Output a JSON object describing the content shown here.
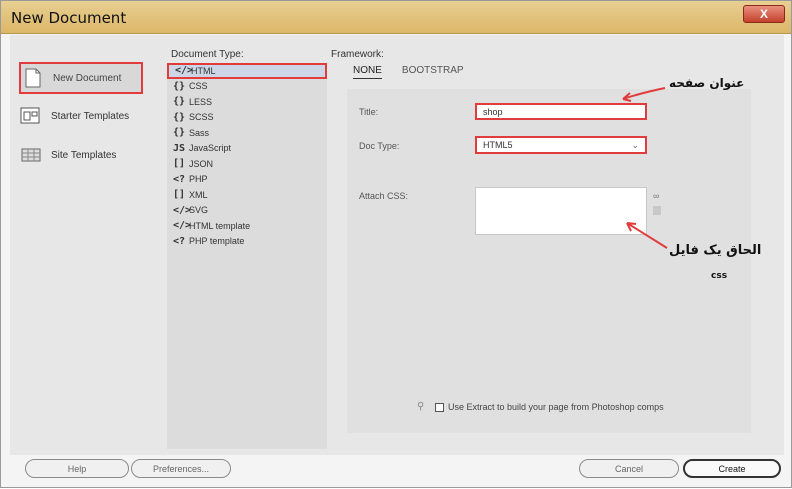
{
  "window": {
    "title": "New Document",
    "close_label": "X"
  },
  "nav": {
    "items": [
      {
        "label": "New Document",
        "icon": "document-icon"
      },
      {
        "label": "Starter Templates",
        "icon": "starter-templates-icon"
      },
      {
        "label": "Site Templates",
        "icon": "site-templates-icon"
      }
    ]
  },
  "doc_type": {
    "label": "Document Type:",
    "items": [
      {
        "label": "HTML",
        "icon": "</>"
      },
      {
        "label": "CSS",
        "icon": "{}"
      },
      {
        "label": "LESS",
        "icon": "{}"
      },
      {
        "label": "SCSS",
        "icon": "{}"
      },
      {
        "label": "Sass",
        "icon": "{}"
      },
      {
        "label": "JavaScript",
        "icon": "JS"
      },
      {
        "label": "JSON",
        "icon": "[]"
      },
      {
        "label": "PHP",
        "icon": "<?"
      },
      {
        "label": "XML",
        "icon": "[]"
      },
      {
        "label": "SVG",
        "icon": "</>"
      },
      {
        "label": "HTML template",
        "icon": "</>"
      },
      {
        "label": "PHP template",
        "icon": "<?"
      }
    ]
  },
  "framework": {
    "label": "Framework:",
    "tabs": [
      "NONE",
      "BOOTSTRAP"
    ],
    "title_label": "Title:",
    "title_value": "shop",
    "doctype_label": "Doc Type:",
    "doctype_value": "HTML5",
    "attach_label": "Attach CSS:",
    "extract_text": "Use Extract to build your page from Photoshop comps"
  },
  "annotations": {
    "page_title": "عنوان صفحه",
    "attach_file": "الحاق یک فایل",
    "css": "css"
  },
  "buttons": {
    "help": "Help",
    "preferences": "Preferences...",
    "cancel": "Cancel",
    "create": "Create"
  },
  "colors": {
    "highlight": "#e23b3b",
    "titlebar": "#dcb768"
  }
}
